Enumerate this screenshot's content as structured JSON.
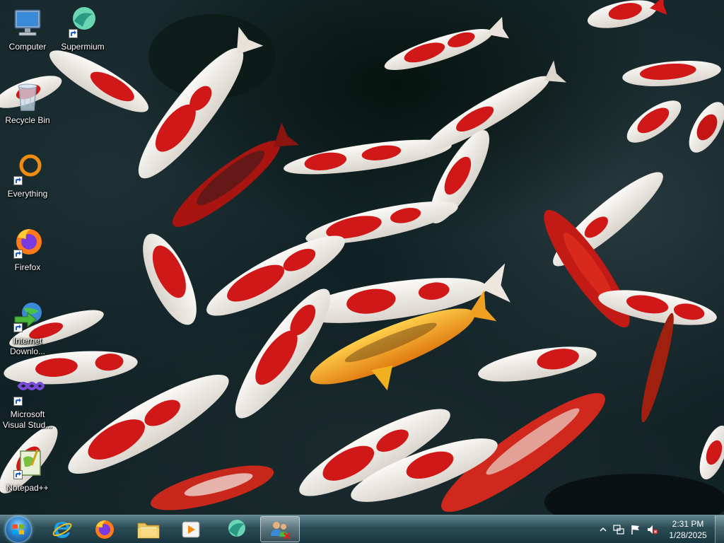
{
  "desktop": {
    "icons": [
      {
        "label": "Computer",
        "icon": "computer-icon"
      },
      {
        "label": "Supermium",
        "icon": "supermium-icon"
      },
      {
        "label": "Recycle Bin",
        "icon": "recycle-bin-icon"
      },
      {
        "label": "Everything",
        "icon": "everything-icon"
      },
      {
        "label": "Firefox",
        "icon": "firefox-icon"
      },
      {
        "label": "Internet Downlo...",
        "icon": "internet-download-manager-icon"
      },
      {
        "label": "Microsoft Visual Stud...",
        "icon": "visual-studio-icon"
      },
      {
        "label": "Notepad++",
        "icon": "notepad-plus-plus-icon"
      }
    ],
    "wallpaper": "koi-fish-pond"
  },
  "taskbar": {
    "pinned": [
      {
        "name": "Internet Explorer",
        "icon": "internet-explorer-icon"
      },
      {
        "name": "Firefox",
        "icon": "firefox-icon"
      },
      {
        "name": "Windows Explorer",
        "icon": "folder-icon"
      },
      {
        "name": "Media Player",
        "icon": "media-player-icon"
      },
      {
        "name": "Supermium",
        "icon": "supermium-icon"
      },
      {
        "name": "Network app",
        "icon": "network-users-icon",
        "active": true
      }
    ],
    "tray": {
      "icons": [
        "show-hidden-icons-chevron",
        "network-icon",
        "action-center-flag-icon",
        "volume-muted-icon"
      ]
    },
    "clock": {
      "time": "2:31 PM",
      "date": "1/28/2025"
    }
  },
  "colors": {
    "taskbar": "#2d505a",
    "koi_red": "#d01818",
    "koi_white": "#f4f0ea",
    "koi_orange": "#f0a020",
    "water": "#142628"
  }
}
